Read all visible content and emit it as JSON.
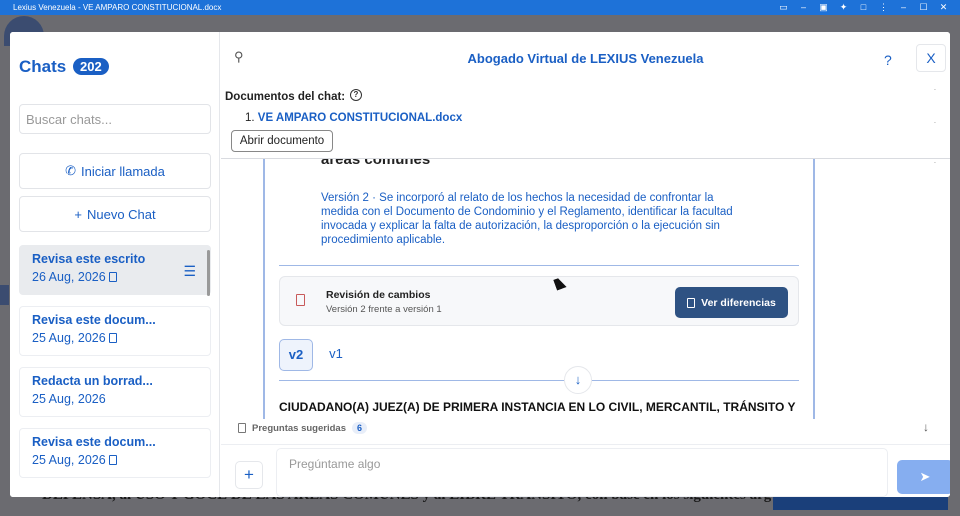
{
  "os": {
    "title": "Lexius Venezuela - VE AMPARO CONSTITUCIONAL.docx",
    "icons": [
      "cast-icon",
      "minimize-icon",
      "restore-icon",
      "extensions-icon",
      "window-icon",
      "more-icon",
      "minimize-window-icon",
      "maximize-window-icon",
      "close-window-icon"
    ]
  },
  "background": {
    "doc_text": "DEFENSA, al USO Y GOCE DE LAS AREAS COMUNES y al LIBRE TRANSITO, con base en los siguientes argumentos de"
  },
  "sidebar": {
    "title": "Chats",
    "count": "202",
    "search_placeholder": "Buscar chats...",
    "call_button": "Iniciar llamada",
    "new_chat_button": "Nuevo Chat",
    "chats": [
      {
        "title": "Revisa este escrito",
        "date": "26 Aug, 2026",
        "has_doc": true,
        "active": true
      },
      {
        "title": "Revisa este docum...",
        "date": "25 Aug, 2026",
        "has_doc": true,
        "active": false
      },
      {
        "title": "Redacta un borrad...",
        "date": "25 Aug, 2026",
        "has_doc": false,
        "active": false
      },
      {
        "title": "Revisa este docum...",
        "date": "25 Aug, 2026",
        "has_doc": true,
        "active": false
      }
    ]
  },
  "header": {
    "title": "Abogado Virtual de LEXIUS Venezuela",
    "help": "?",
    "close": "X"
  },
  "documents": {
    "label": "Documentos del chat:",
    "items": [
      {
        "index": "1.",
        "name": "VE AMPARO CONSTITUCIONAL.docx"
      }
    ],
    "open_button": "Abrir documento"
  },
  "content": {
    "cut_heading": "áreas comunes",
    "version_note": "Versión 2 · Se incorporó al relato de los hechos la necesidad de confrontar la medida con el Documento de Condominio y el Reglamento, identificar la facultad invocada y explicar la falta de autorización, la desproporción o la ejecución sin procedimiento aplicable.",
    "revision": {
      "title": "Revisión de cambios",
      "subtitle": "Versión 2 frente a versión 1",
      "button": "Ver diferencias"
    },
    "versions": [
      "v2",
      "v1"
    ],
    "court_text": "CIUDADANO(A) JUEZ(A) DE PRIMERA INSTANCIA EN LO CIVIL, MERCANTIL, TRÁNSITO Y"
  },
  "suggestions": {
    "label": "Preguntas sugeridas",
    "count": "6"
  },
  "composer": {
    "placeholder": "Pregúntame algo",
    "plus": "+",
    "send": "➤"
  }
}
